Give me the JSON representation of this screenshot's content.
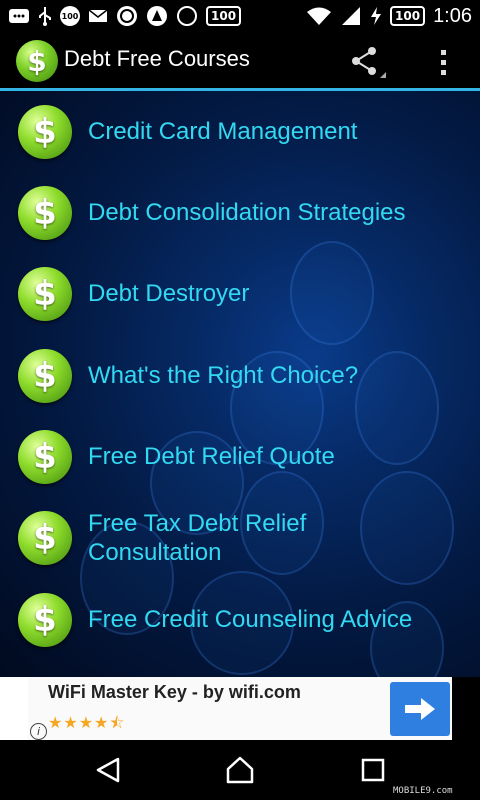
{
  "status_bar": {
    "left_icons": [
      "message-icon",
      "usb-icon",
      "100-circle-icon",
      "mail-icon",
      "app-circle-icon",
      "app-triangle-icon",
      "c-icon",
      "battery-100-icon"
    ],
    "circle_badge": "100",
    "c_letter": "C",
    "left_badge": "100",
    "battery": "100",
    "time": "1:06"
  },
  "action_bar": {
    "logo_symbol": "$",
    "title": "Debt Free Courses",
    "accent_color": "#33b5e5"
  },
  "list": {
    "items": [
      {
        "symbol": "$",
        "label": "Credit Card Management"
      },
      {
        "symbol": "$",
        "label": "Debt Consolidation Strategies"
      },
      {
        "symbol": "$",
        "label": "Debt Destroyer"
      },
      {
        "symbol": "$",
        "label": "What's the Right Choice?"
      },
      {
        "symbol": "$",
        "label": "Free Debt Relief Quote"
      },
      {
        "symbol": "$",
        "label": "Free Tax Debt Relief Consultation"
      },
      {
        "symbol": "$",
        "label": "Free Credit Counseling Advice"
      }
    ],
    "label_color": "#33d9f2"
  },
  "ad": {
    "title": "WiFi Master Key - by wifi.com",
    "rating": 4.5,
    "stars": "★★★★⯪",
    "info_symbol": "i"
  },
  "watermark": "MOBILE9.com"
}
